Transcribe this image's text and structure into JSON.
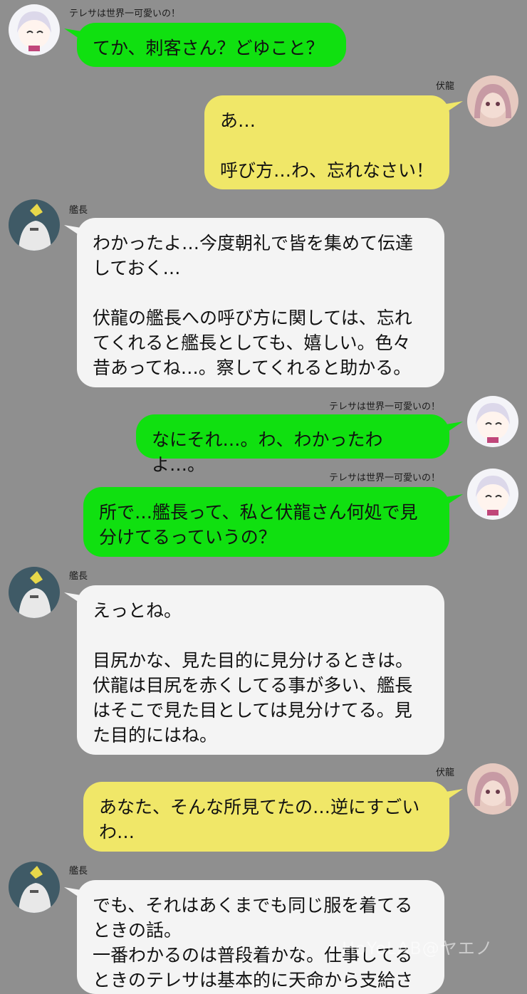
{
  "colors": {
    "background": "#8f8f8f",
    "green_bubble": "#10e010",
    "yellow_bubble": "#f0e768",
    "white_bubble": "#f4f4f4"
  },
  "messages": [
    {
      "sender": "テレサは世界一可愛いの！",
      "side": "left",
      "color": "green",
      "avatar_icon": "white-haired-girl-avatar-icon",
      "text": "てか、刺客さん？どゆこと？"
    },
    {
      "sender": "伏龍",
      "side": "right",
      "color": "yellow",
      "avatar_icon": "pink-haired-girl-avatar-icon",
      "text": "あ…\n\n呼び方…わ、忘れなさい！"
    },
    {
      "sender": "艦長",
      "side": "left",
      "color": "white",
      "avatar_icon": "captain-avatar-icon",
      "text": "わかったよ…今度朝礼で皆を集めて伝達\nしておく…\n\n伏龍の艦長への呼び方に関しては、忘れ\nてくれると艦長としても、嬉しい。色々\n昔あってね…。察してくれると助かる。"
    },
    {
      "sender": "テレサは世界一可愛いの！",
      "side": "right",
      "color": "green",
      "avatar_icon": "white-haired-girl-avatar-icon",
      "text": "なにそれ…。わ、わかったわよ…。"
    },
    {
      "sender": "テレサは世界一可愛いの！",
      "side": "right",
      "color": "green",
      "avatar_icon": "white-haired-girl-avatar-icon",
      "text": "所で…艦長って、私と伏龍さん何処で見\n分けてるっていうの？"
    },
    {
      "sender": "艦長",
      "side": "left",
      "color": "white",
      "avatar_icon": "captain-avatar-icon",
      "text": "えっとね。\n\n目尻かな、見た目的に見分けるときは。\n伏龍は目尻を赤くしてる事が多い、艦長\nはそこで見た目としては見分けてる。見\nた目的にはね。"
    },
    {
      "sender": "伏龍",
      "side": "right",
      "color": "yellow",
      "avatar_icon": "pink-haired-girl-avatar-icon",
      "text": "あなた、そんな所見てたの…逆にすごい\nわ…"
    },
    {
      "sender": "艦長",
      "side": "left",
      "color": "white",
      "avatar_icon": "captain-avatar-icon",
      "text": "でも、それはあくまでも同じ服を着てる\nときの話。\n一番わかるのは普段着かな。仕事してる\nときのテレサは基本的に天命から支給さ"
    }
  ],
  "watermark": "HoYoLAB@ヤエノ"
}
